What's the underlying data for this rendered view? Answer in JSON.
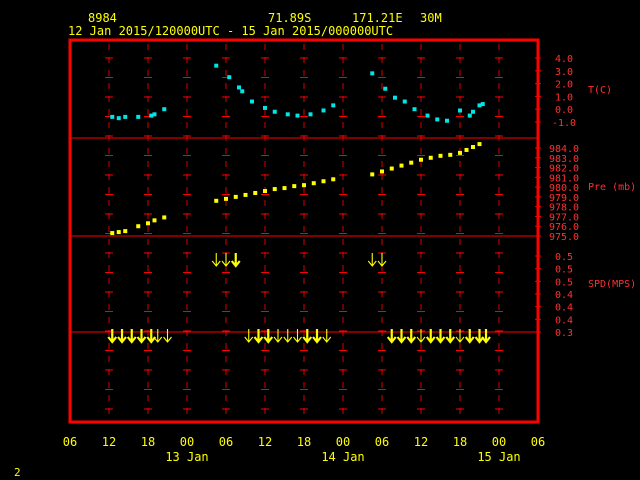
{
  "header": {
    "station": "8984",
    "lat": "71.89S",
    "lon": "171.21E",
    "interval": "30M",
    "period": "12 Jan 2015/120000UTC - 15 Jan 2015/000000UTC"
  },
  "footer_number": "2",
  "colors": {
    "background": "#000000",
    "frame": "#ff0000",
    "axis_text": "#ff3030",
    "header_text": "#ffff00",
    "temperature": "#00e5e5",
    "pressure": "#ffff00",
    "wind": "#ffff00"
  },
  "chart_data": {
    "type": "scatter",
    "time_axis": {
      "unit": "hours after 12 Jan 2015 06 UTC",
      "range": [
        0,
        72
      ],
      "tick_step": 6,
      "tick_labels": [
        "06",
        "12",
        "18",
        "00",
        "06",
        "12",
        "18",
        "00",
        "06",
        "12",
        "18",
        "00",
        "06"
      ],
      "date_labels": [
        {
          "hour": 18,
          "label": "13 Jan"
        },
        {
          "hour": 42,
          "label": "14 Jan"
        },
        {
          "hour": 66,
          "label": "15 Jan"
        }
      ]
    },
    "panels": [
      {
        "id": "temperature",
        "ylabel": "T(C)",
        "range": [
          -1.0,
          4.0
        ],
        "ticks": [
          "4.0",
          "3.0",
          "2.0",
          "1.0",
          "0.0",
          "-1.0"
        ],
        "series": [
          {
            "points": [
              [
                6.5,
                -0.6
              ],
              [
                7.5,
                -0.7
              ],
              [
                8.5,
                -0.6
              ],
              [
                10.5,
                -0.6
              ],
              [
                12.5,
                -0.5
              ],
              [
                13,
                -0.4
              ],
              [
                14.5,
                0.0
              ],
              [
                22.5,
                3.4
              ],
              [
                24.5,
                2.5
              ],
              [
                26,
                1.7
              ],
              [
                26.5,
                1.4
              ],
              [
                28,
                0.6
              ],
              [
                30,
                0.1
              ],
              [
                31.5,
                -0.2
              ],
              [
                33.5,
                -0.4
              ],
              [
                35,
                -0.5
              ],
              [
                37,
                -0.4
              ],
              [
                39,
                -0.1
              ],
              [
                40.5,
                0.3
              ],
              [
                46.5,
                2.8
              ],
              [
                48.5,
                1.6
              ],
              [
                50,
                0.9
              ],
              [
                51.5,
                0.6
              ],
              [
                53,
                0.0
              ],
              [
                55,
                -0.5
              ],
              [
                56.5,
                -0.8
              ],
              [
                58,
                -0.9
              ],
              [
                60,
                -0.1
              ],
              [
                61.5,
                -0.5
              ],
              [
                62,
                -0.2
              ],
              [
                63,
                0.3
              ],
              [
                63.5,
                0.4
              ]
            ]
          }
        ]
      },
      {
        "id": "pressure",
        "ylabel": "Pre (mb)",
        "range": [
          975.0,
          984.0
        ],
        "ticks": [
          "984.0",
          "983.0",
          "982.0",
          "981.0",
          "980.0",
          "979.0",
          "978.0",
          "977.0",
          "976.0",
          "975.0"
        ],
        "series": [
          {
            "points": [
              [
                6.5,
                975.3
              ],
              [
                7.5,
                975.4
              ],
              [
                8.5,
                975.5
              ],
              [
                10.5,
                976.0
              ],
              [
                12,
                976.3
              ],
              [
                13,
                976.6
              ],
              [
                14.5,
                976.9
              ],
              [
                22.5,
                978.6
              ],
              [
                24,
                978.8
              ],
              [
                25.5,
                979.0
              ],
              [
                27,
                979.2
              ],
              [
                28.5,
                979.4
              ],
              [
                30,
                979.6
              ],
              [
                31.5,
                979.8
              ],
              [
                33,
                979.9
              ],
              [
                34.5,
                980.1
              ],
              [
                36,
                980.2
              ],
              [
                37.5,
                980.4
              ],
              [
                39,
                980.6
              ],
              [
                40.5,
                980.8
              ],
              [
                46.5,
                981.3
              ],
              [
                48,
                981.6
              ],
              [
                49.5,
                981.9
              ],
              [
                51,
                982.2
              ],
              [
                52.5,
                982.5
              ],
              [
                54,
                982.8
              ],
              [
                55.5,
                983.0
              ],
              [
                57,
                983.2
              ],
              [
                58.5,
                983.3
              ],
              [
                60,
                983.5
              ],
              [
                61,
                983.8
              ],
              [
                62,
                984.1
              ],
              [
                63,
                984.4
              ]
            ]
          }
        ]
      },
      {
        "id": "wind",
        "ylabel": "SPD(MPS)",
        "range": [
          0.3,
          0.5
        ],
        "ticks": [
          "0.5",
          "0.5",
          "0.5",
          "0.4",
          "0.4",
          "0.4",
          "0.3"
        ],
        "arrow_rows": [
          {
            "level": 0.5,
            "times": [
              [
                22.5,
                "thin"
              ],
              [
                24,
                "thin"
              ],
              [
                25.5,
                "thick"
              ],
              [
                46.5,
                "thin"
              ],
              [
                48,
                "thin"
              ]
            ]
          },
          {
            "level": 0.3,
            "times": [
              [
                6.5,
                "thick"
              ],
              [
                8,
                "thick"
              ],
              [
                9.5,
                "thick"
              ],
              [
                11,
                "thick"
              ],
              [
                12.5,
                "thick"
              ],
              [
                13.5,
                "thin"
              ],
              [
                15,
                "thin"
              ],
              [
                27.5,
                "thin"
              ],
              [
                29,
                "thick"
              ],
              [
                30.5,
                "thick"
              ],
              [
                32,
                "thin"
              ],
              [
                33.5,
                "thin"
              ],
              [
                35,
                "thin"
              ],
              [
                36.5,
                "thick"
              ],
              [
                38,
                "thick"
              ],
              [
                39.5,
                "thin"
              ],
              [
                49.5,
                "thick"
              ],
              [
                51,
                "thick"
              ],
              [
                52.5,
                "thick"
              ],
              [
                54,
                "thin"
              ],
              [
                55.5,
                "thick"
              ],
              [
                57,
                "thick"
              ],
              [
                58.5,
                "thick"
              ],
              [
                60,
                "thin"
              ],
              [
                61.5,
                "thick"
              ],
              [
                63,
                "thick"
              ],
              [
                64,
                "thick"
              ]
            ]
          }
        ]
      }
    ]
  }
}
